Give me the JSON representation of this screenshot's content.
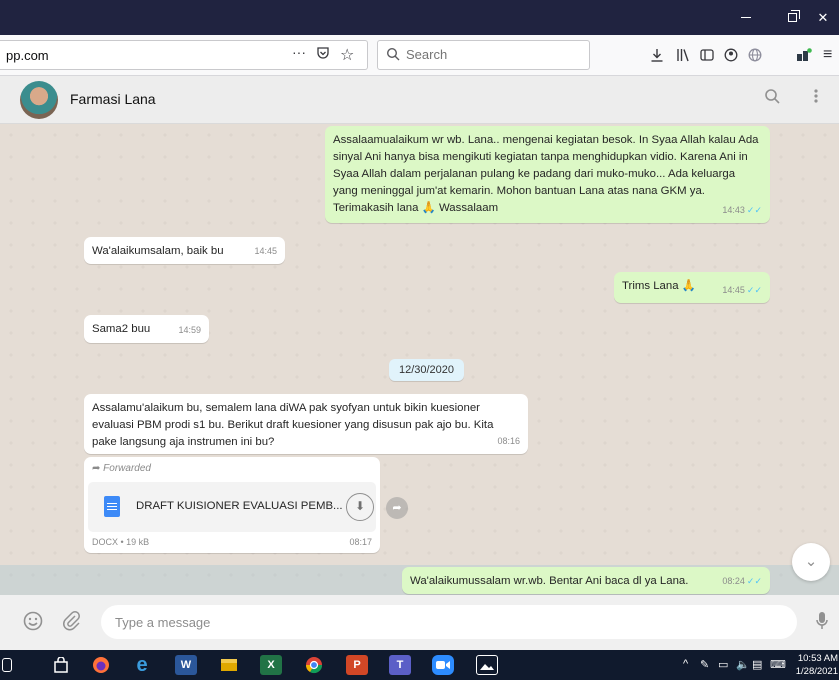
{
  "browser": {
    "url": "pp.com",
    "search_placeholder": "Search",
    "icons": [
      "more-icon",
      "pocket-icon",
      "bookmark-star-icon",
      "download-icon",
      "library-icon",
      "sidebar-icon",
      "account-icon",
      "extension-icon",
      "addon-icon",
      "menu-icon"
    ]
  },
  "chat": {
    "contact_name": "Farmasi Lana",
    "messages": [
      {
        "direction": "out",
        "text": "Assalaamualaikum wr wb. Lana.. mengenai kegiatan besok. In Syaa Allah kalau Ada sinyal Ani hanya bisa mengikuti kegiatan tanpa menghidupkan vidio. Karena Ani in Syaa Allah dalam perjalanan pulang ke padang dari muko-muko... Ada keluarga yang meninggal jum'at kemarin. Mohon bantuan Lana atas nana GKM ya. Terimakasih lana 🙏 Wassalaam",
        "time": "14:43"
      },
      {
        "direction": "in",
        "text": "Wa'alaikumsalam, baik bu",
        "time": "14:45"
      },
      {
        "direction": "out",
        "text": "Trims Lana 🙏",
        "time": "14:45"
      },
      {
        "direction": "in",
        "text": "Sama2 buu",
        "time": "14:59"
      },
      {
        "direction": "in",
        "text": "Assalamu'alaikum bu, semalem lana diWA pak syofyan untuk bikin kuesioner evaluasi PBM prodi s1 bu. Berikut draft kuesioner yang disusun pak ajo bu. Kita pake langsung aja instrumen ini bu?",
        "time": "08:16"
      },
      {
        "direction": "out",
        "text": "Wa'alaikumussalam wr.wb. Bentar Ani baca dl ya Lana.",
        "time": "08:24"
      }
    ],
    "date_divider": "12/30/2020",
    "file": {
      "forwarded_label": "Forwarded",
      "name": "DRAFT KUISIONER EVALUASI PEMB...",
      "meta": "DOCX • 19 kB",
      "time": "08:17"
    },
    "composer_placeholder": "Type a message"
  },
  "taskbar": {
    "apps": [
      "task-view",
      "store",
      "firefox",
      "edge",
      "word",
      "file-explorer",
      "excel",
      "chrome",
      "powerpoint",
      "teams",
      "zoom",
      "photos"
    ],
    "time": "10:53 AM",
    "date": "1/28/2021"
  },
  "colors": {
    "titlebar": "#202340",
    "outgoing_bubble": "#dcf8c6",
    "incoming_bubble": "#ffffff",
    "chat_bg": "#e5ddd5",
    "read_ticks": "#4fc3f7",
    "taskbar": "#101a2d"
  }
}
